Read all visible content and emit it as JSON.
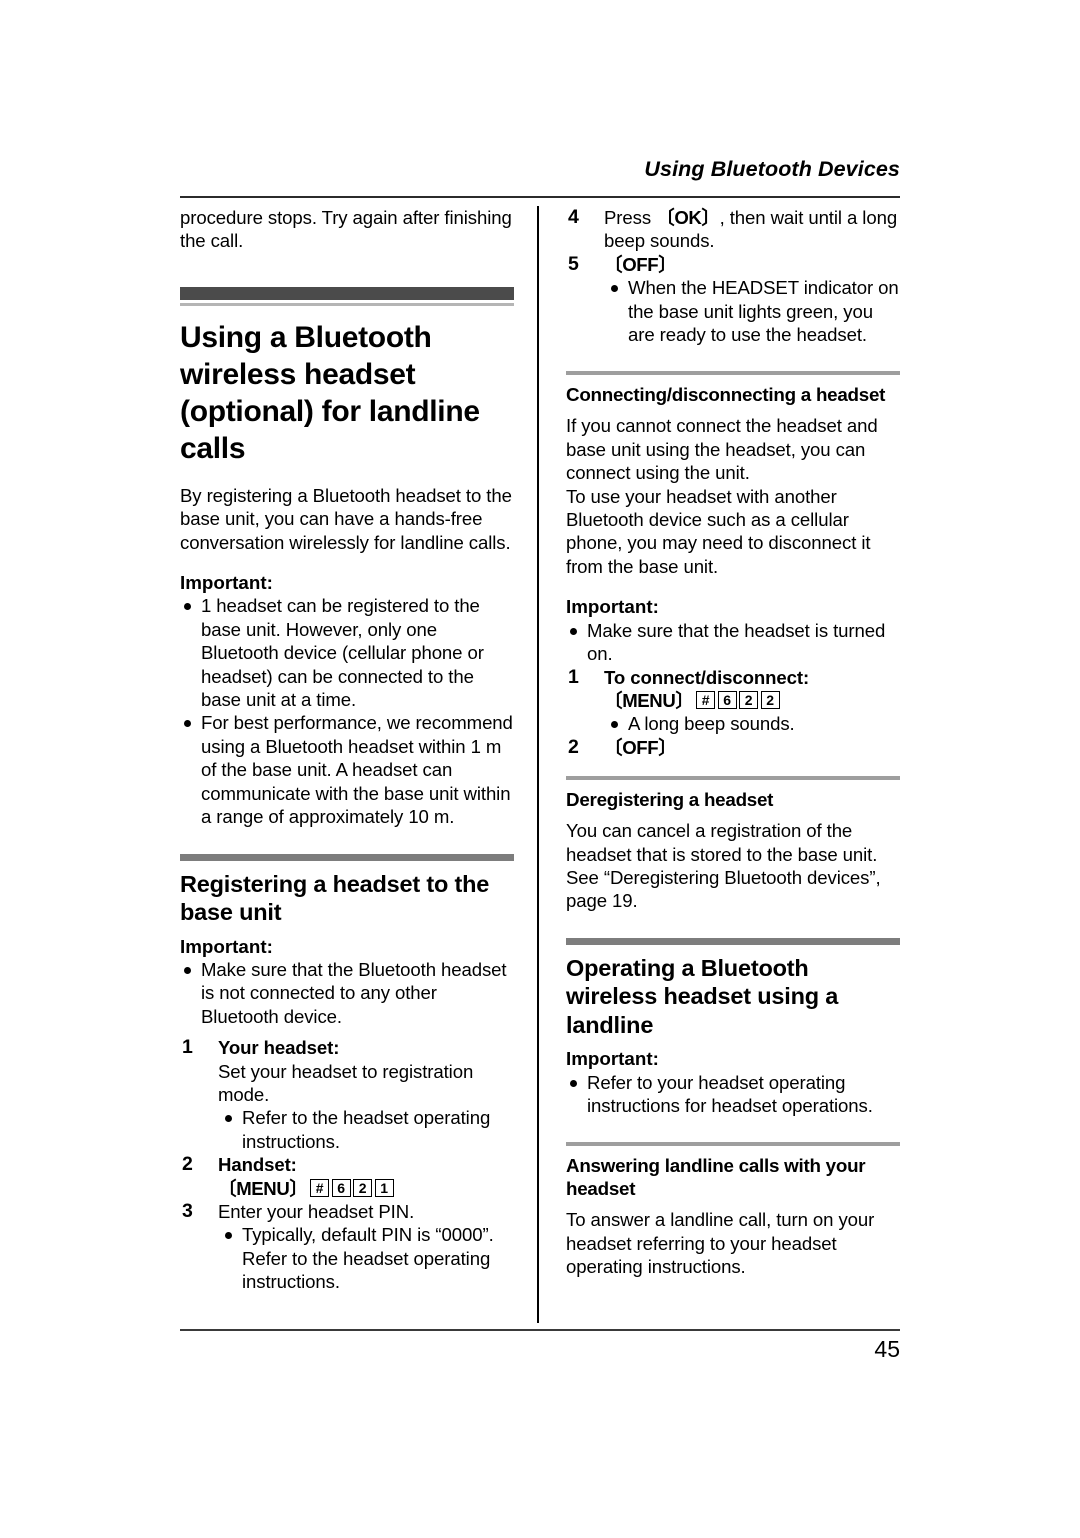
{
  "header": {
    "running_title": "Using Bluetooth Devices"
  },
  "footer": {
    "page_number": "45"
  },
  "left_column": {
    "continued_paragraph": "procedure stops. Try again after finishing the call.",
    "major_heading": "Using a Bluetooth wireless headset (optional) for landline calls",
    "intro_paragraph": "By registering a Bluetooth headset to the base unit, you can have a hands-free conversation wirelessly for landline calls.",
    "important_label": "Important:",
    "important_bullets": [
      "1 headset can be registered to the base unit. However, only one Bluetooth device (cellular phone or headset) can be connected to the base unit at a time.",
      "For best performance, we recommend using a Bluetooth headset within 1 m of the base unit. A headset can communicate with the base unit within a range of approximately 10 m."
    ],
    "section_heading": "Registering a headset to the base unit",
    "section_important_label": "Important:",
    "section_important_bullets": [
      "Make sure that the Bluetooth headset is not connected to any other Bluetooth device."
    ],
    "steps": [
      {
        "number": "1",
        "bold_line": "Your headset:",
        "text": "Set your headset to registration mode.",
        "bullets": [
          "Refer to the headset operating instructions."
        ]
      },
      {
        "number": "2",
        "bold_line": "Handset:",
        "key_sequence": {
          "key_label": "MENU",
          "keys": [
            "#",
            "6",
            "2",
            "1"
          ]
        }
      },
      {
        "number": "3",
        "text": "Enter your headset PIN.",
        "bullets_rich": [
          {
            "prefix": "Typically, default PIN is ",
            "quoted": "“0000”",
            "suffix": ". Refer to the headset operating instructions."
          }
        ]
      }
    ]
  },
  "right_column": {
    "steps_continued": [
      {
        "number": "4",
        "prefix": "Press ",
        "key_label": "OK",
        "suffix": ", then wait until a long beep sounds."
      },
      {
        "number": "5",
        "key_label": "OFF",
        "bullets": [
          "When the HEADSET indicator on the base unit lights green, you are ready to use the headset."
        ]
      }
    ],
    "sub_connecting": {
      "heading": "Connecting/disconnecting a headset",
      "paragraph_1": "If you cannot connect the headset and base unit using the headset, you can connect using the unit.",
      "paragraph_2": "To use your headset with another Bluetooth device such as a cellular phone, you may need to disconnect it from the base unit.",
      "important_label": "Important:",
      "important_bullets": [
        "Make sure that the headset is turned on."
      ],
      "steps": [
        {
          "number": "1",
          "bold_line": "To connect/disconnect:",
          "key_sequence": {
            "key_label": "MENU",
            "keys": [
              "#",
              "6",
              "2",
              "2"
            ]
          },
          "bullets": [
            "A long beep sounds."
          ]
        },
        {
          "number": "2",
          "key_label": "OFF"
        }
      ]
    },
    "sub_deregistering": {
      "heading": "Deregistering a headset",
      "paragraph": "You can cancel a registration of the headset that is stored to the base unit. See “Deregistering Bluetooth devices”, page 19."
    },
    "section_operating": {
      "heading": "Operating a Bluetooth wireless headset using a landline",
      "important_label": "Important:",
      "important_bullets": [
        "Refer to your headset operating instructions for headset operations."
      ]
    },
    "sub_answering": {
      "heading": "Answering landline calls with your headset",
      "paragraph": "To answer a landline call, turn on your headset referring to your headset operating instructions."
    }
  },
  "colors": {
    "bar_major": "#4b4b4b",
    "bar_section": "#7d7d7d",
    "bar_sub": "#9e9e9e",
    "rule": "#2b2b2b"
  }
}
